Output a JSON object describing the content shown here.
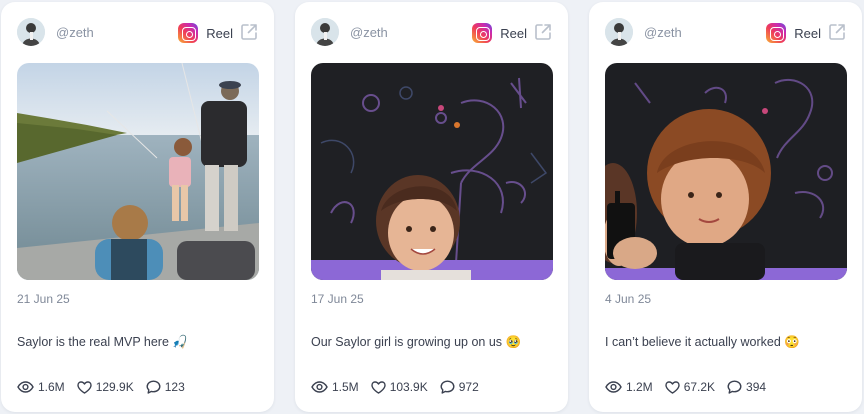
{
  "posts": [
    {
      "username": "@zeth",
      "platform_icon": "instagram-icon",
      "post_type": "Reel",
      "date": "21 Jun 25",
      "caption": "Saylor is the real MVP here 🎣",
      "views": "1.6M",
      "likes": "129.9K",
      "comments": "123"
    },
    {
      "username": "@zeth",
      "platform_icon": "instagram-icon",
      "post_type": "Reel",
      "date": "17 Jun 25",
      "caption": "Our Saylor girl is growing up on us 🥹",
      "views": "1.5M",
      "likes": "103.9K",
      "comments": "972"
    },
    {
      "username": "@zeth",
      "platform_icon": "instagram-icon",
      "post_type": "Reel",
      "date": "4 Jun 25",
      "caption": "I can’t believe it actually worked 😳",
      "views": "1.2M",
      "likes": "67.2K",
      "comments": "394"
    }
  ],
  "colors": {
    "page_background": "#eef1f6",
    "card_background": "#ffffff",
    "muted_text": "#8a93a3",
    "body_text": "#3b4150"
  }
}
